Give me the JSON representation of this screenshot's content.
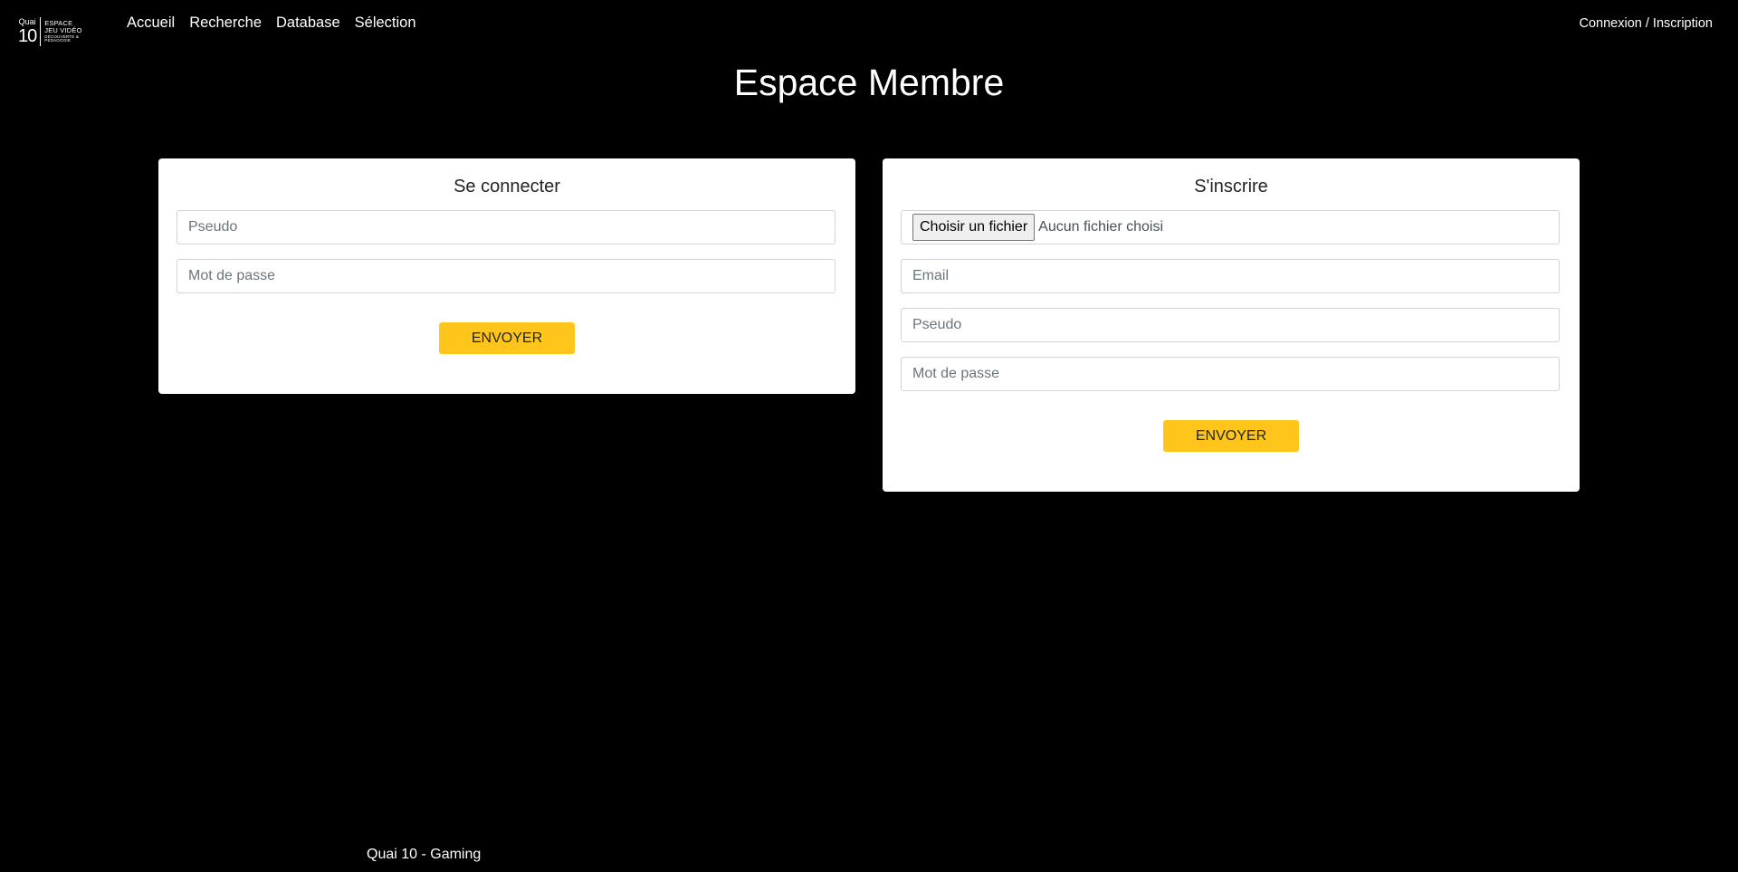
{
  "header": {
    "logo": {
      "top_text": "Quai",
      "number": "10",
      "line1": "ESPACE",
      "line2": "JEU VIDÉO",
      "line3": "DÉCOUVERTE & PÉDAGOGIE"
    },
    "nav": [
      {
        "label": "Accueil"
      },
      {
        "label": "Recherche"
      },
      {
        "label": "Database"
      },
      {
        "label": "Sélection"
      }
    ],
    "auth_link": "Connexion / Inscription"
  },
  "page": {
    "title": "Espace Membre"
  },
  "login": {
    "title": "Se connecter",
    "pseudo_placeholder": "Pseudo",
    "password_placeholder": "Mot de passe",
    "submit_label": "ENVOYER"
  },
  "register": {
    "title": "S'inscrire",
    "file_button_label": "Choisir un fichier",
    "file_status": "Aucun fichier choisi",
    "email_placeholder": "Email",
    "pseudo_placeholder": "Pseudo",
    "password_placeholder": "Mot de passe",
    "submit_label": "ENVOYER"
  },
  "footer": {
    "text": "Quai 10 - Gaming"
  },
  "colors": {
    "background": "#000000",
    "card": "#ffffff",
    "accent": "#ffc51a"
  }
}
